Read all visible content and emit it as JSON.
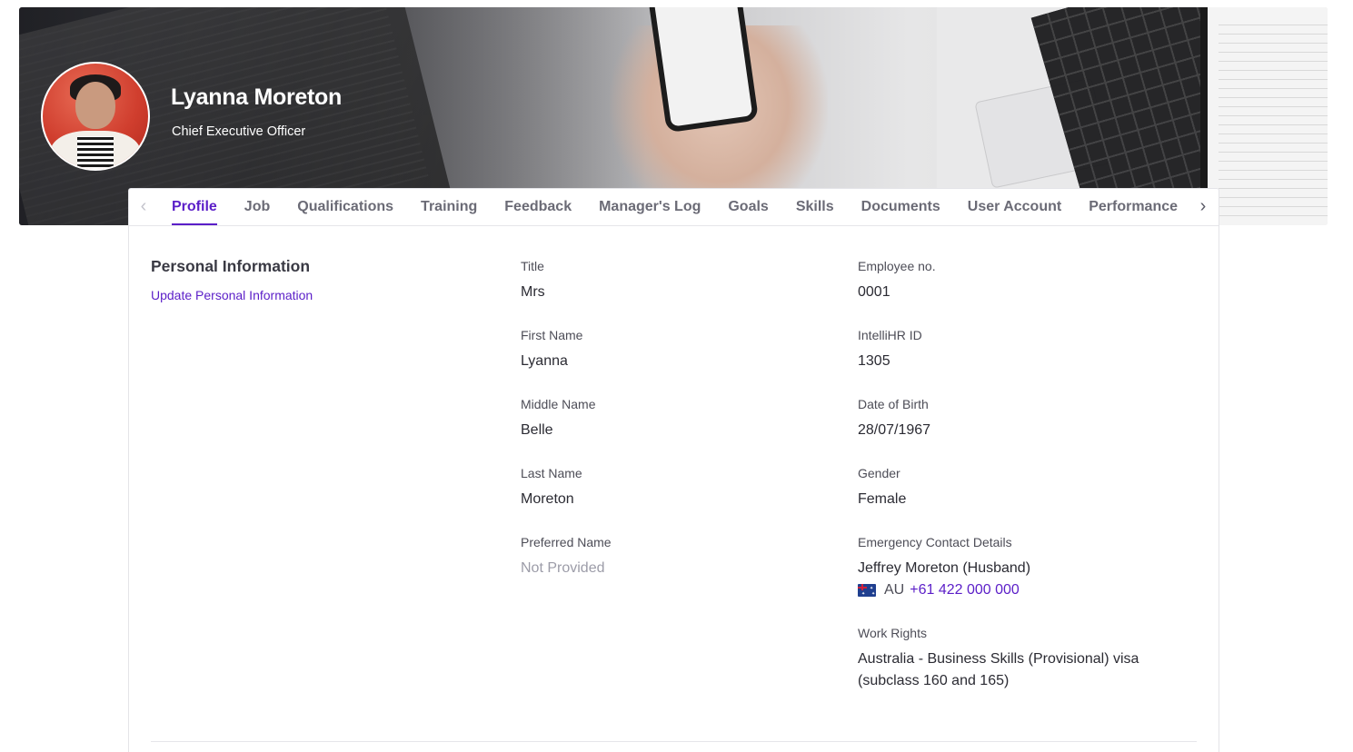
{
  "header": {
    "name": "Lyanna Moreton",
    "role": "Chief Executive Officer"
  },
  "tabs": [
    {
      "label": "Profile",
      "active": true
    },
    {
      "label": "Job"
    },
    {
      "label": "Qualifications"
    },
    {
      "label": "Training"
    },
    {
      "label": "Feedback"
    },
    {
      "label": "Manager's Log"
    },
    {
      "label": "Goals"
    },
    {
      "label": "Skills"
    },
    {
      "label": "Documents"
    },
    {
      "label": "User Account"
    },
    {
      "label": "Performance"
    }
  ],
  "section": {
    "title": "Personal Information",
    "update_link": "Update Personal Information"
  },
  "fields_left": {
    "title": {
      "label": "Title",
      "value": "Mrs"
    },
    "first_name": {
      "label": "First Name",
      "value": "Lyanna"
    },
    "middle_name": {
      "label": "Middle Name",
      "value": "Belle"
    },
    "last_name": {
      "label": "Last Name",
      "value": "Moreton"
    },
    "preferred_name": {
      "label": "Preferred Name",
      "value": "Not Provided"
    }
  },
  "fields_right": {
    "employee_no": {
      "label": "Employee no.",
      "value": "0001"
    },
    "intellihr_id": {
      "label": "IntelliHR ID",
      "value": "1305"
    },
    "dob": {
      "label": "Date of Birth",
      "value": "28/07/1967"
    },
    "gender": {
      "label": "Gender",
      "value": "Female"
    },
    "emergency": {
      "label": "Emergency Contact Details",
      "value": "Jeffrey Moreton (Husband)",
      "country_code": "AU",
      "phone": "+61 422 000 000"
    },
    "work_rights": {
      "label": "Work Rights",
      "value_line1": "Australia - Business Skills (Provisional) visa",
      "value_line2": "(subclass 160 and 165)"
    }
  },
  "icons": {
    "tab_prev": "chevron-left-icon",
    "tab_next": "chevron-right-icon",
    "flag": "australia-flag-icon"
  },
  "colors": {
    "accent": "#5b1ec8",
    "muted_text": "#9c9ca8"
  }
}
